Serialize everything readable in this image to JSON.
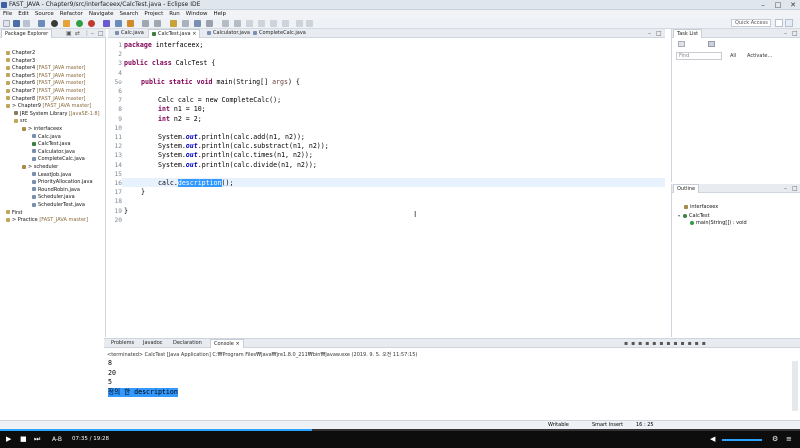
{
  "window": {
    "title": "FAST_JAVA - Chapter9/src/interfaceex/CalcTest.java - Eclipse IDE",
    "min": "–",
    "max": "□",
    "close": "✕"
  },
  "menu": [
    "File",
    "Edit",
    "Source",
    "Refactor",
    "Navigate",
    "Search",
    "Project",
    "Run",
    "Window",
    "Help"
  ],
  "quick_access": {
    "placeholder": "Quick Access"
  },
  "package_explorer": {
    "tab": "Package Explorer",
    "items": [
      {
        "label": "Chapter2",
        "dec": ""
      },
      {
        "label": "Chapter3",
        "dec": ""
      },
      {
        "label": "Chapter4",
        "dec": " [FAST_JAVA master]"
      },
      {
        "label": "Chapter5",
        "dec": " [FAST_JAVA master]"
      },
      {
        "label": "Chapter6",
        "dec": " [FAST_JAVA master]"
      },
      {
        "label": "Chapter7",
        "dec": " [FAST_JAVA master]"
      },
      {
        "label": "Chapter8",
        "dec": " [FAST_JAVA master]"
      },
      {
        "label": "> Chapter9",
        "dec": " [FAST_JAVA master]"
      },
      {
        "label": "JRE System Library",
        "dec": " [JavaSE-1.8]"
      },
      {
        "label": "src",
        "dec": ""
      },
      {
        "label": "> interfaceex",
        "dec": ""
      },
      {
        "label": "Calc.java",
        "dec": ""
      },
      {
        "label": "CalcTest.java",
        "dec": ""
      },
      {
        "label": "Calculator.java",
        "dec": ""
      },
      {
        "label": "CompleteCalc.java",
        "dec": ""
      },
      {
        "label": "> scheduler",
        "dec": ""
      },
      {
        "label": "LeastJob.java",
        "dec": ""
      },
      {
        "label": "PriorityAllocation.java",
        "dec": ""
      },
      {
        "label": "RoundRobin.java",
        "dec": ""
      },
      {
        "label": "Scheduler.java",
        "dec": ""
      },
      {
        "label": "SchedulerTest.java",
        "dec": ""
      },
      {
        "label": "First",
        "dec": ""
      },
      {
        "label": "> Practice",
        "dec": " [FAST_JAVA master]"
      }
    ]
  },
  "editor": {
    "tabs": [
      "Calc.java",
      "CalcTest.java",
      "Calculator.java",
      "CompleteCalc.java"
    ],
    "line_numbers": [
      "1",
      "2",
      "3",
      "4",
      "5⊖",
      "6",
      "7",
      "8",
      "9",
      "10",
      "11",
      "12",
      "13",
      "14",
      "15",
      "16",
      "17",
      "18",
      "19",
      "20"
    ],
    "code": {
      "l1a": "package",
      "l1b": " interfaceex;",
      "l3a": "public",
      "l3b": " ",
      "l3c": "class",
      "l3d": " CalcTest {",
      "l5a": "public",
      "l5b": "static",
      "l5c": "void",
      "l5d": " main(String[] ",
      "l5e": "args",
      "l5f": ") {",
      "l7": "Calc calc = new CompleteCalc();",
      "l8a": "int",
      "l8b": " n1 = 10;",
      "l9a": "int",
      "l9b": " n2 = 2;",
      "l11a": "System.",
      "l11b": "out",
      "l11c": ".println(calc.add(n1, n2));",
      "l12a": "System.",
      "l12b": "out",
      "l12c": ".println(calc.substract(n1, n2));",
      "l13a": "System.",
      "l13b": "out",
      "l13c": ".println(calc.times(n1, n2));",
      "l14a": "System.",
      "l14b": "out",
      "l14c": ".println(calc.divide(n1, n2));",
      "l16a": "calc.",
      "l16b": "description",
      "l16c": "();",
      "l17": "}",
      "l19": "}"
    }
  },
  "task_list": {
    "tab": "Task List",
    "find_placeholder": "Find",
    "all": "All",
    "activate": "Activate..."
  },
  "outline": {
    "tab": "Outline",
    "items": [
      "interfaceex",
      "CalcTest",
      "main(String[]) : void"
    ]
  },
  "console": {
    "tabs": [
      "Problems",
      "Javadoc",
      "Declaration",
      "Console"
    ],
    "terminated": "<terminated> CalcTest [Java Application] C:₩Program Files₩Java₩jre1.8.0_211₩bin₩javaw.exe (2019. 9. 5. 오전 11:57:15)",
    "output": [
      "8",
      "20",
      "5"
    ],
    "highlight": "정의 한 description"
  },
  "status": {
    "writable": "Writable",
    "insert": "Smart Insert",
    "position": "16 : 25"
  },
  "player": {
    "ab": "A-B",
    "time": "07:35 / 19:28",
    "progress": 0.39
  }
}
